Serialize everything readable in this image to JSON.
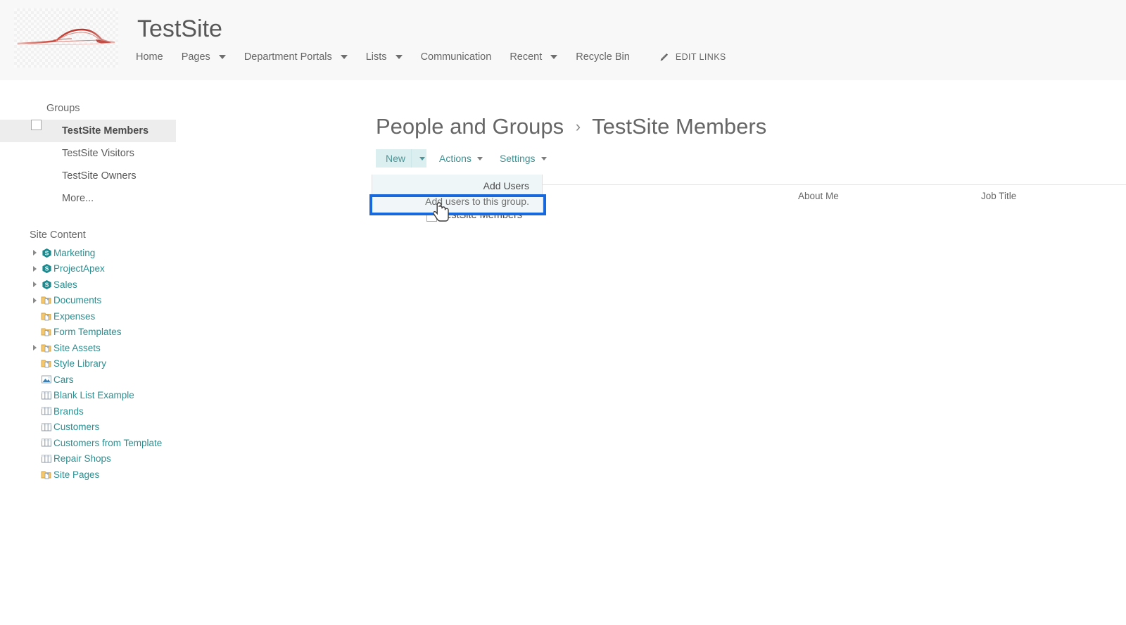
{
  "header": {
    "site_title": "TestSite",
    "logo_icon": "car-silhouette-logo",
    "nav": [
      {
        "label": "Home",
        "has_caret": false
      },
      {
        "label": "Pages",
        "has_caret": true
      },
      {
        "label": "Department Portals",
        "has_caret": true
      },
      {
        "label": "Lists",
        "has_caret": true
      },
      {
        "label": "Communication",
        "has_caret": false
      },
      {
        "label": "Recent",
        "has_caret": true
      },
      {
        "label": "Recycle Bin",
        "has_caret": false
      }
    ],
    "edit_links": {
      "label": "EDIT LINKS",
      "icon": "pencil-icon"
    }
  },
  "sidebar": {
    "groups_heading": "Groups",
    "groups": [
      {
        "label": "TestSite Members",
        "selected": true
      },
      {
        "label": "TestSite Visitors",
        "selected": false
      },
      {
        "label": "TestSite Owners",
        "selected": false
      },
      {
        "label": "More...",
        "selected": false
      }
    ],
    "site_content_heading": "Site Content",
    "tree": [
      {
        "label": "Marketing",
        "icon": "sharepoint-site-icon",
        "expandable": true
      },
      {
        "label": "ProjectApex",
        "icon": "sharepoint-site-icon",
        "expandable": true
      },
      {
        "label": "Sales",
        "icon": "sharepoint-site-icon",
        "expandable": true
      },
      {
        "label": "Documents",
        "icon": "document-library-icon",
        "expandable": true
      },
      {
        "label": "Expenses",
        "icon": "document-library-icon",
        "expandable": false
      },
      {
        "label": "Form Templates",
        "icon": "document-library-icon",
        "expandable": false
      },
      {
        "label": "Site Assets",
        "icon": "document-library-icon",
        "expandable": true
      },
      {
        "label": "Style Library",
        "icon": "document-library-icon",
        "expandable": false
      },
      {
        "label": "Cars",
        "icon": "picture-library-icon",
        "expandable": false
      },
      {
        "label": "Blank List Example",
        "icon": "list-icon",
        "expandable": false
      },
      {
        "label": "Brands",
        "icon": "list-icon",
        "expandable": false
      },
      {
        "label": "Customers",
        "icon": "list-icon",
        "expandable": false
      },
      {
        "label": "Customers from Template",
        "icon": "list-icon",
        "expandable": false
      },
      {
        "label": "Repair Shops",
        "icon": "list-icon",
        "expandable": false
      },
      {
        "label": "Site Pages",
        "icon": "document-library-icon",
        "expandable": false
      }
    ]
  },
  "main": {
    "breadcrumb": {
      "parent": "People and Groups",
      "separator": "›",
      "current": "TestSite Members"
    },
    "toolbar": {
      "new_label": "New",
      "actions_label": "Actions",
      "settings_label": "Settings"
    },
    "new_menu": {
      "title": "Add Users",
      "description": "Add users to this group.",
      "highlight_color": "#1668dc",
      "highlight_target": "Add users to this group."
    },
    "table": {
      "columns": [
        "About Me",
        "Job Title"
      ],
      "rows": [
        {
          "name": "TestSite Members",
          "about_me": "",
          "job_title": "",
          "checked": false
        }
      ],
      "select_all_checked": false
    }
  },
  "colors": {
    "accent_teal": "#3f9394",
    "link_teal": "#2a8f91",
    "highlight_blue": "#1668dc",
    "toolbar_active_bg": "#dceff0",
    "header_bg": "#f8f8f8",
    "selected_item_bg": "#ededed",
    "logo_red": "#c0392b"
  }
}
